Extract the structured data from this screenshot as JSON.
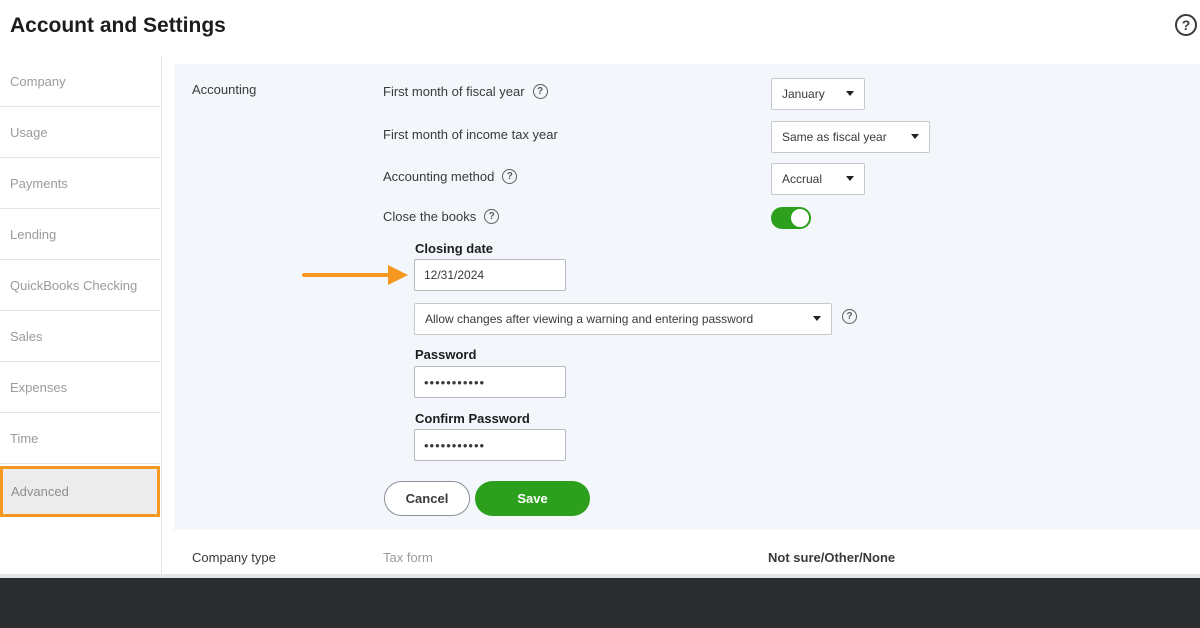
{
  "header": {
    "title": "Account and Settings",
    "help_glyph": "?"
  },
  "sidebar": {
    "items": [
      {
        "label": "Company"
      },
      {
        "label": "Usage"
      },
      {
        "label": "Payments"
      },
      {
        "label": "Lending"
      },
      {
        "label": "QuickBooks Checking"
      },
      {
        "label": "Sales"
      },
      {
        "label": "Expenses"
      },
      {
        "label": "Time"
      },
      {
        "label": "Advanced",
        "active": true
      }
    ]
  },
  "accounting": {
    "section_label": "Accounting",
    "fiscal_year": {
      "label": "First month of fiscal year",
      "value": "January"
    },
    "income_tax_year": {
      "label": "First month of income tax year",
      "value": "Same as fiscal year"
    },
    "accounting_method": {
      "label": "Accounting method",
      "value": "Accrual"
    },
    "close_books": {
      "label": "Close the books",
      "enabled": true
    },
    "closing_date": {
      "label": "Closing date",
      "value": "12/31/2024"
    },
    "change_policy": {
      "value": "Allow changes after viewing a warning and entering password"
    },
    "password": {
      "label": "Password",
      "value": "•••••••••••"
    },
    "confirm_password": {
      "label": "Confirm Password",
      "value": "•••••••••••"
    },
    "cancel_label": "Cancel",
    "save_label": "Save"
  },
  "company_type": {
    "label": "Company type",
    "tax_form_label": "Tax form",
    "tax_form_value": "Not sure/Other/None"
  },
  "colors": {
    "accent_green": "#2ca01c",
    "highlight_orange": "#f4981f"
  },
  "icons": {
    "help": "help-circle-icon",
    "dropdown": "caret-down-icon",
    "pointer": "arrow-right-icon"
  }
}
